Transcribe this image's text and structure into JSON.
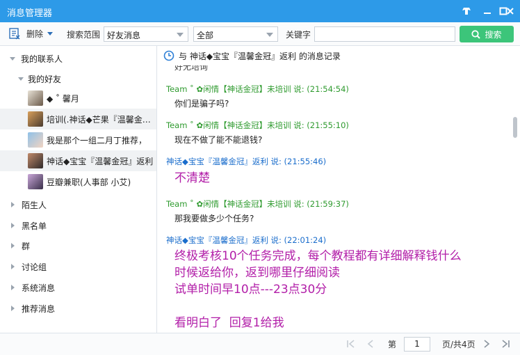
{
  "window": {
    "title": "消息管理器"
  },
  "toolbar": {
    "delete_label": "删除",
    "scope_label": "搜索范围",
    "scope_value": "好友消息",
    "type_value": "全部",
    "keyword_label": "关键字",
    "keyword_value": "",
    "search_label": "搜索"
  },
  "sidebar": {
    "my_contacts": "我的联系人",
    "my_friends": "我的好友",
    "friends": [
      {
        "name": "◆ ˚ 馨月"
      },
      {
        "name": "培训(.神话◆芒果『温馨金冠』"
      },
      {
        "name": "我是那个一组二月丁推荐，"
      },
      {
        "name": "神话◆宝宝『温馨金冠』返利"
      },
      {
        "name": "豆瓣兼职(人事部 小艾)"
      }
    ],
    "groups": [
      {
        "label": "陌生人"
      },
      {
        "label": "黑名单"
      },
      {
        "label": "群"
      },
      {
        "label": "讨论组"
      },
      {
        "label": "系统消息"
      },
      {
        "label": "推荐消息"
      }
    ]
  },
  "content": {
    "header": "与 神话◆宝宝『温馨金冠』返利 的消息记录",
    "partial_text": "好无培询",
    "messages": [
      {
        "sender": "Team ˚ ✿闲情【神话金冠】未培训 说: (21:54:54)",
        "text": "你们是骗子吗?"
      },
      {
        "sender": "Team ˚ ✿闲情【神话金冠】未培训 说: (21:55:10)",
        "text": "现在不做了能不能退钱?"
      },
      {
        "sender": "神话◆宝宝『温馨金冠』返利 说: (21:55:46)",
        "text": "不清楚"
      },
      {
        "sender": "Team ˚ ✿闲情【神话金冠】未培训 说: (21:59:37)",
        "text": "那我要做多少个任务?"
      },
      {
        "sender": "神话◆宝宝『温馨金冠』返利 说: (22:01:24)",
        "text": "终极考核10个任务完成，每个教程都有详细解释钱什么\n时候返给你，返到哪里仔细阅读\n试单时间早10点---23点30分\n\n看明白了  回复1给我"
      }
    ]
  },
  "footer": {
    "page_prefix": "第",
    "page_value": "1",
    "page_suffix": "页/共4页"
  },
  "colors": {
    "titlebar": "#2d9ae8",
    "search_button": "#3cc57a",
    "friend_sender": "#2e9a2e",
    "self_sender": "#1a6dcc",
    "big_text": "#b21ea8"
  }
}
